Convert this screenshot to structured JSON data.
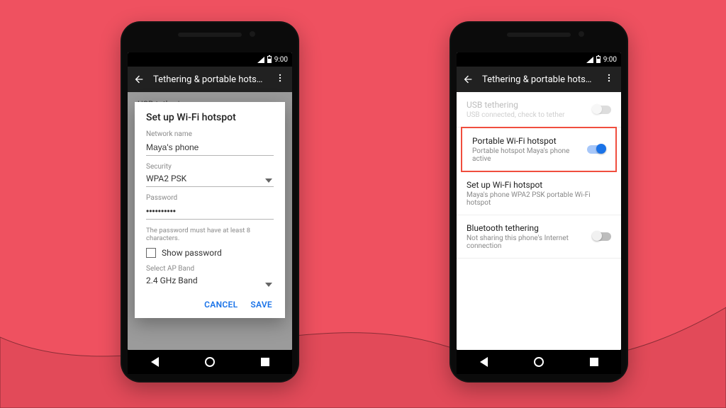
{
  "colors": {
    "background": "#ef5160",
    "accent": "#1a73e8",
    "highlight": "#f04e3e"
  },
  "status": {
    "time": "9:00"
  },
  "appbar": {
    "title": "Tethering & portable hotspot"
  },
  "dialog": {
    "title": "Set up Wi-Fi hotspot",
    "network_name_label": "Network name",
    "network_name_value": "Maya's phone",
    "security_label": "Security",
    "security_value": "WPA2 PSK",
    "password_label": "Password",
    "password_value": "••••••••••",
    "password_hint": "The password must have at least 8 characters.",
    "show_password_label": "Show password",
    "ap_band_label": "Select AP Band",
    "ap_band_value": "2.4 GHz Band",
    "cancel": "CANCEL",
    "save": "SAVE"
  },
  "bg_rows": {
    "usb_title": "USB tethering",
    "portable_prefix": "P",
    "setup_prefix": "S",
    "bluetooth_prefix": "B"
  },
  "settings": {
    "usb": {
      "title": "USB tethering",
      "sub": "USB connected, check to tether"
    },
    "portable": {
      "title": "Portable Wi-Fi hotspot",
      "sub": "Portable hotspot Maya's phone active"
    },
    "setup": {
      "title": "Set up Wi-Fi hotspot",
      "sub": "Maya's phone WPA2 PSK portable Wi-Fi hotspot"
    },
    "bluetooth": {
      "title": "Bluetooth tethering",
      "sub": "Not sharing this phone's Internet connection"
    }
  }
}
